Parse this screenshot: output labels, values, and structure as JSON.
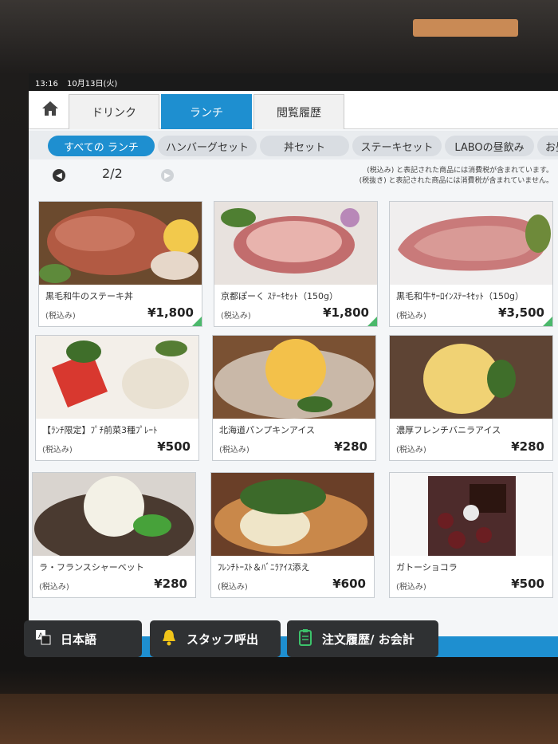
{
  "status": {
    "time": "13:16",
    "date": "10月13日(火)"
  },
  "nav": {
    "home_icon": "home-icon",
    "tabs": [
      {
        "label": "ドリンク",
        "active": false
      },
      {
        "label": "ランチ",
        "active": true
      },
      {
        "label": "閲覧履歴",
        "active": false
      }
    ]
  },
  "categories": [
    {
      "label": "すべての ランチ",
      "active": true
    },
    {
      "label": "ハンバーグセット",
      "active": false
    },
    {
      "label": "丼セット",
      "active": false
    },
    {
      "label": "ステーキセット",
      "active": false
    },
    {
      "label": "LABOの昼飲み",
      "active": false
    },
    {
      "label": "お昼",
      "active": false
    }
  ],
  "pager": {
    "page": "2/2"
  },
  "tax_note": {
    "line1": "(税込み) と表記された商品には消費税が含まれています。",
    "line2": "(税抜き) と表記された商品には消費税が含まれていません。"
  },
  "items": [
    {
      "name": "黒毛和牛のステーキ丼",
      "tax": "(税込み)",
      "price": "¥1,800"
    },
    {
      "name": "京都ぽーく ｽﾃｰｷｾｯﾄ（150g）",
      "tax": "(税込み)",
      "price": "¥1,800"
    },
    {
      "name": "黒毛和牛ｻｰﾛｲﾝｽﾃｰｷｾｯﾄ（150g）",
      "tax": "(税込み)",
      "price": "¥3,500"
    },
    {
      "name": "【ﾗﾝﾁ限定】ﾌﾟﾁ前菜3種ﾌﾟﾚｰﾄ",
      "tax": "(税込み)",
      "price": "¥500"
    },
    {
      "name": "北海道パンプキンアイス",
      "tax": "(税込み)",
      "price": "¥280"
    },
    {
      "name": "濃厚フレンチバニラアイス",
      "tax": "(税込み)",
      "price": "¥280"
    },
    {
      "name": "ラ・フランスシャーベット",
      "tax": "(税込み)",
      "price": "¥280"
    },
    {
      "name": "ﾌﾚﾝﾁﾄｰｽﾄ＆ﾊﾞﾆﾗｱｲｽ添え",
      "tax": "(税込み)",
      "price": "¥600"
    },
    {
      "name": "ガトーショコラ",
      "tax": "(税込み)",
      "price": "¥500"
    }
  ],
  "bottom": {
    "language": {
      "label": "日本語",
      "icon": "language-icon"
    },
    "staff": {
      "label": "スタッフ呼出",
      "icon": "bell-icon"
    },
    "history": {
      "label": "注文履歴/ お会計",
      "icon": "clipboard-icon"
    }
  },
  "colors": {
    "accent": "#1e8fd0",
    "badge": "#4bb86b",
    "bell": "#f0c419",
    "clipboard": "#3cc36b"
  }
}
